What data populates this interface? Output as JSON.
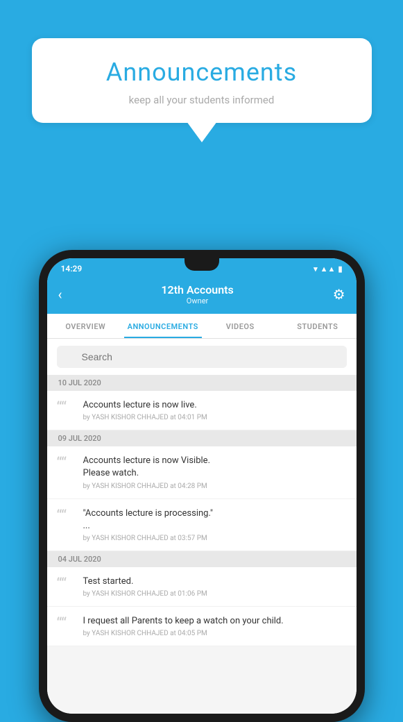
{
  "bubble": {
    "title": "Announcements",
    "subtitle": "keep all your students informed"
  },
  "phone": {
    "statusBar": {
      "time": "14:29",
      "wifi": "▾",
      "signal": "▲▲",
      "battery": "▮"
    },
    "appBar": {
      "title": "12th Accounts",
      "subtitle": "Owner",
      "backIcon": "‹",
      "settingsIcon": "⚙"
    },
    "tabs": [
      {
        "label": "OVERVIEW",
        "active": false
      },
      {
        "label": "ANNOUNCEMENTS",
        "active": true
      },
      {
        "label": "VIDEOS",
        "active": false
      },
      {
        "label": "STUDENTS",
        "active": false
      }
    ],
    "search": {
      "placeholder": "Search"
    },
    "announcements": [
      {
        "dateHeader": "10 JUL 2020",
        "items": [
          {
            "text": "Accounts lecture is now live.",
            "meta": "by YASH KISHOR CHHAJED at 04:01 PM"
          }
        ]
      },
      {
        "dateHeader": "09 JUL 2020",
        "items": [
          {
            "text": "Accounts lecture is now Visible.\nPlease watch.",
            "meta": "by YASH KISHOR CHHAJED at 04:28 PM"
          },
          {
            "text": "\"Accounts lecture is processing.\"\n...",
            "meta": "by YASH KISHOR CHHAJED at 03:57 PM"
          }
        ]
      },
      {
        "dateHeader": "04 JUL 2020",
        "items": [
          {
            "text": "Test started.",
            "meta": "by YASH KISHOR CHHAJED at 01:06 PM"
          },
          {
            "text": "I request all Parents to keep a watch on your child.",
            "meta": "by YASH KISHOR CHHAJED at 04:05 PM"
          }
        ]
      }
    ]
  }
}
